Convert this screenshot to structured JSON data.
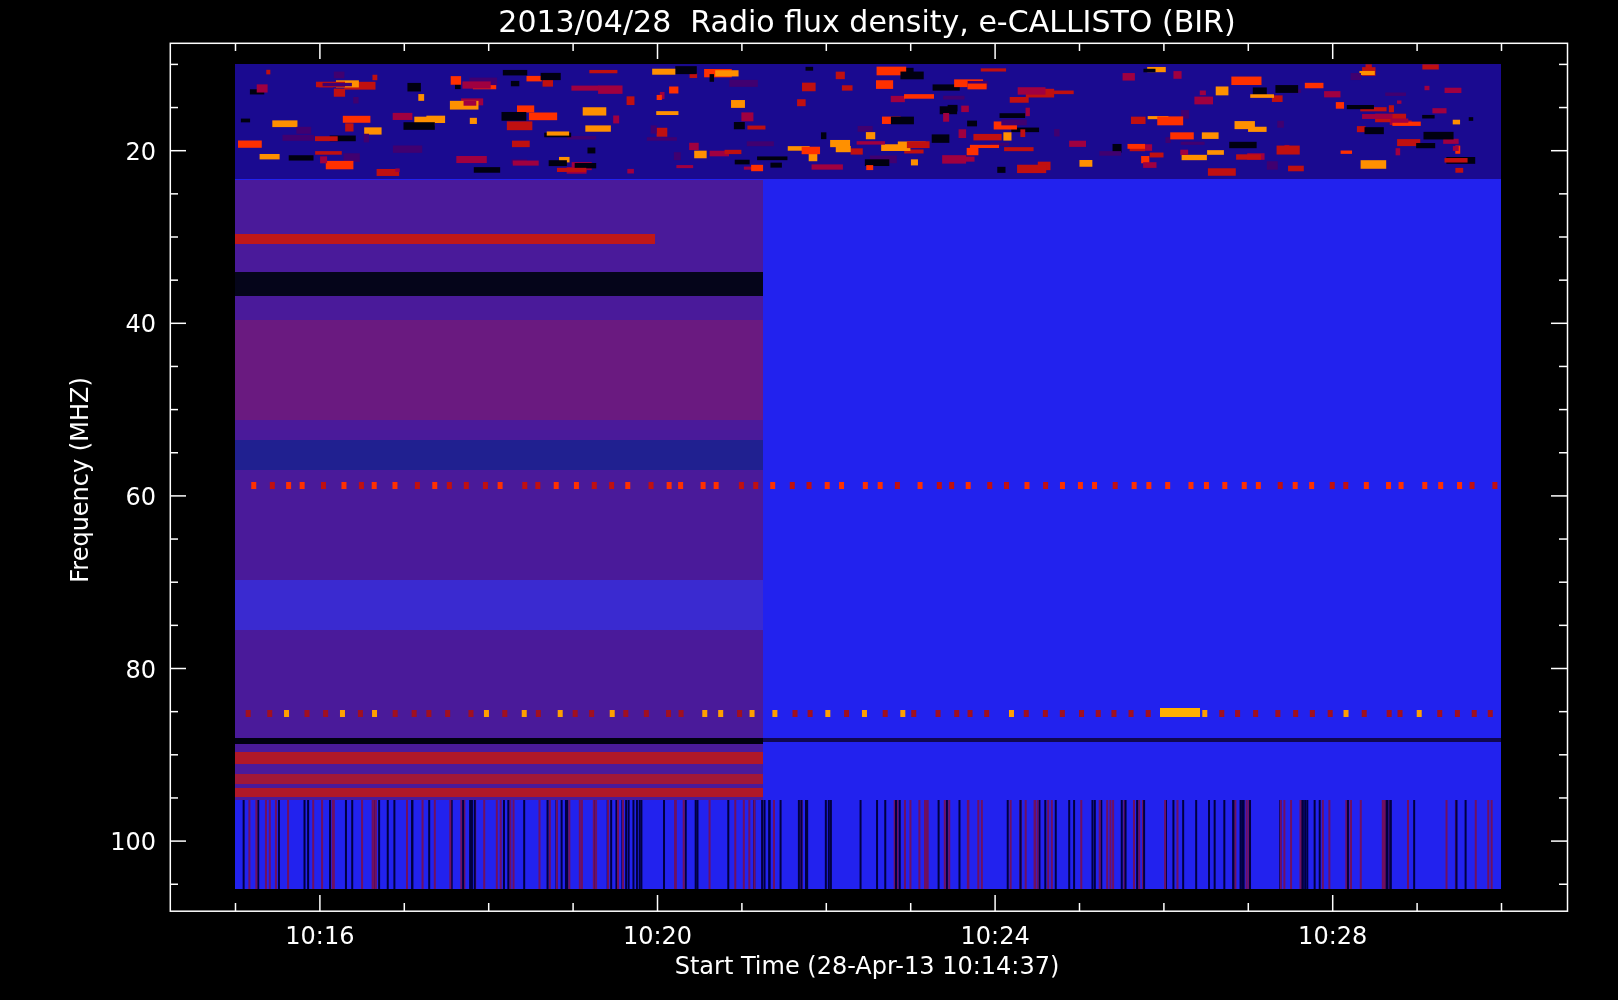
{
  "title": "2013/04/28  Radio flux density, e-CALLISTO (BIR)",
  "y_axis": {
    "label": "Frequency (MHZ)",
    "ticks": [
      "20",
      "40",
      "60",
      "80",
      "100"
    ]
  },
  "x_axis": {
    "label": "Start Time (28-Apr-13 10:14:37)",
    "ticks": [
      "10:16",
      "10:20",
      "10:24",
      "10:28"
    ]
  }
}
